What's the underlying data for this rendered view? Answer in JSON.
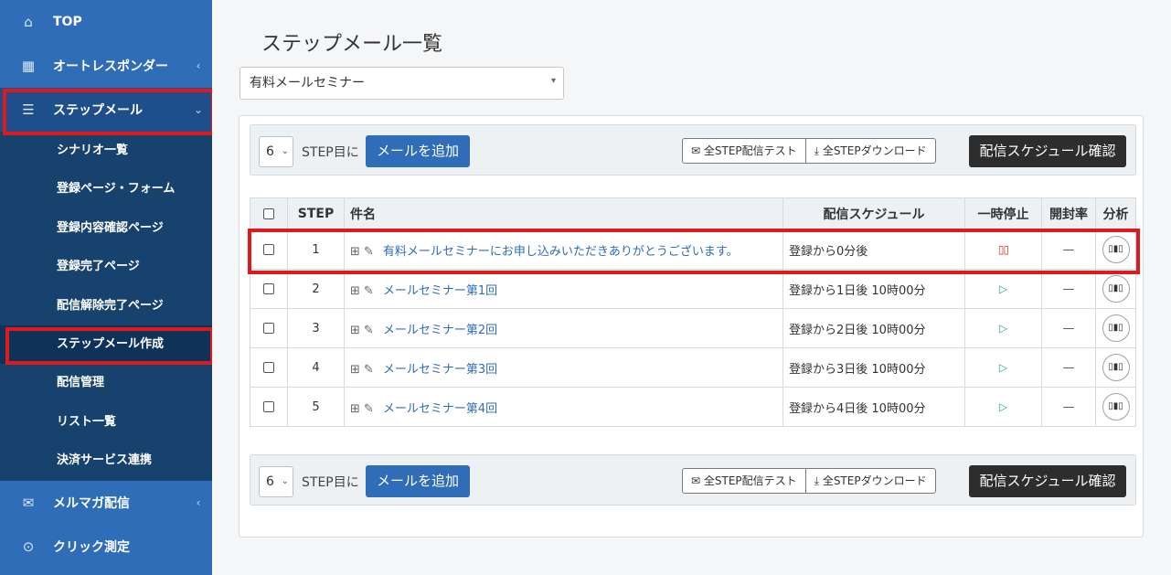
{
  "sidebar": {
    "top": {
      "label": "TOP",
      "icon": "home-icon"
    },
    "autoresponder": {
      "label": "オートレスポンダー",
      "chevron": "‹"
    },
    "stepmail": {
      "label": "ステップメール",
      "chevron": "⌄"
    },
    "subitems": [
      "シナリオ一覧",
      "登録ページ・フォーム",
      "登録内容確認ページ",
      "登録完了ページ",
      "配信解除完了ページ",
      "ステップメール作成",
      "配信管理",
      "リスト一覧",
      "決済サービス連携"
    ],
    "mailmag": {
      "label": "メルマガ配信",
      "chevron": "‹"
    },
    "click": {
      "label": "クリック測定"
    }
  },
  "main": {
    "title": "ステップメール一覧",
    "scenario": "有料メールセミナー",
    "toolbar": {
      "step_value": "6",
      "step_suffix": "STEP目に",
      "add_label": "メールを追加",
      "test_all_label": "全STEP配信テスト",
      "download_all_label": "全STEPダウンロード",
      "schedule_label": "配信スケジュール確認"
    },
    "table": {
      "headers": {
        "step": "STEP",
        "subject": "件名",
        "schedule": "配信スケジュール",
        "pause": "一時停止",
        "open_rate": "開封率",
        "analysis": "分析"
      },
      "rows": [
        {
          "step": "1",
          "subject": "有料メールセミナーにお申し込みいただきありがとうございます。",
          "schedule": "登録から0分後",
          "paused": true,
          "open_rate": "—"
        },
        {
          "step": "2",
          "subject": "メールセミナー第1回",
          "schedule": "登録から1日後 10時00分",
          "paused": false,
          "open_rate": "—"
        },
        {
          "step": "3",
          "subject": "メールセミナー第2回",
          "schedule": "登録から2日後 10時00分",
          "paused": false,
          "open_rate": "—"
        },
        {
          "step": "4",
          "subject": "メールセミナー第3回",
          "schedule": "登録から3日後 10時00分",
          "paused": false,
          "open_rate": "—"
        },
        {
          "step": "5",
          "subject": "メールセミナー第4回",
          "schedule": "登録から4日後 10時00分",
          "paused": false,
          "open_rate": "—"
        }
      ]
    }
  },
  "colors": {
    "sidebar": "#2f6db8",
    "sidebar_sub": "#17426e",
    "accent": "#2f6db8",
    "highlight": "#e01a1a",
    "pause": "#d9342b",
    "play": "#2aa58e"
  }
}
